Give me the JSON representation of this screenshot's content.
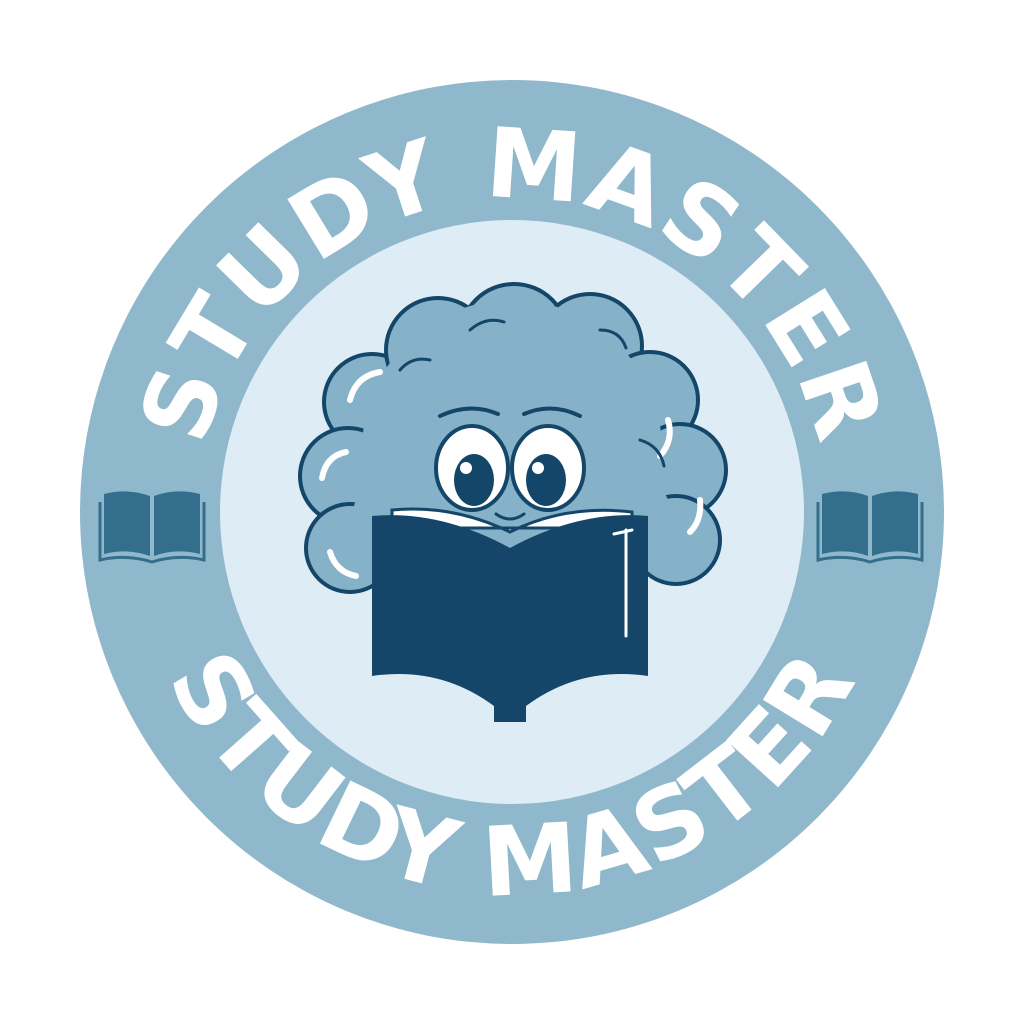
{
  "badge": {
    "top_text": "STUDY MASTER",
    "bottom_text": "STUDY MASTER",
    "colors": {
      "background": "#ffffff",
      "outer_ring": "#8fb8cc",
      "inner_disc": "#deedf5",
      "text": "#ffffff",
      "book_icons": "#336f8d",
      "brain": "#85b2c8",
      "brain_outline": "#134669",
      "brain_highlight": "#ffffff",
      "book_cover": "#154669",
      "eyes": "#134669"
    },
    "icons": {
      "left": "open-book-icon",
      "right": "open-book-icon",
      "mascot": "brain-reading-book-mascot"
    }
  }
}
